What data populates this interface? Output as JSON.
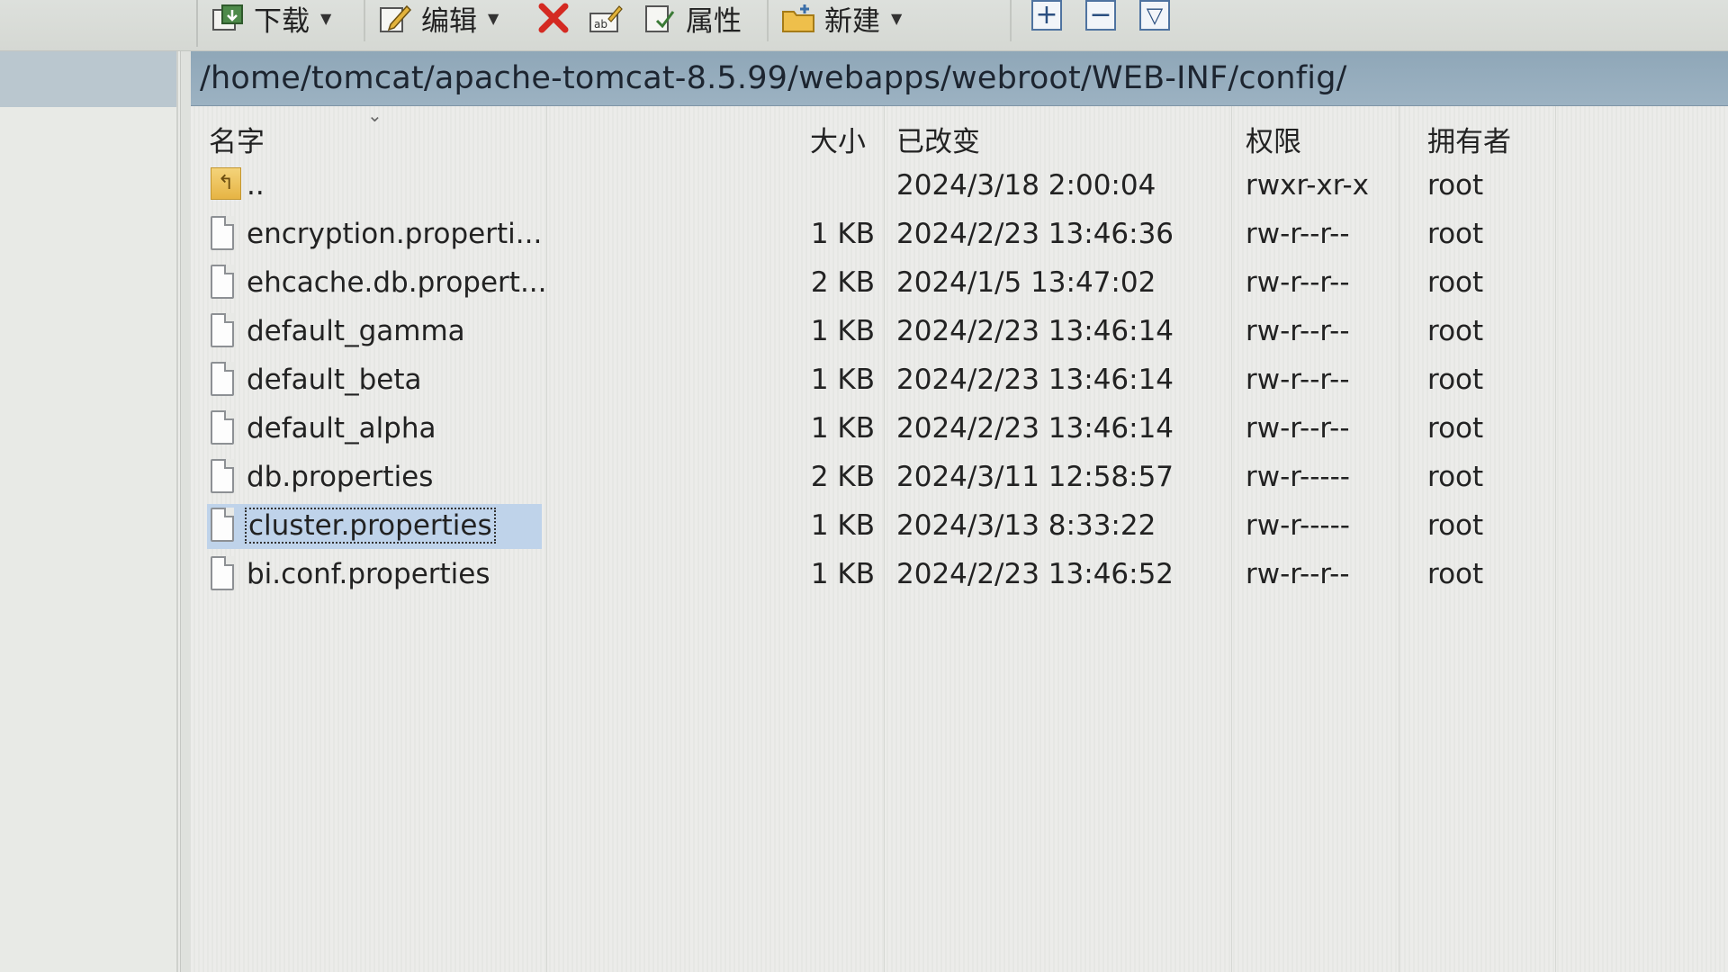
{
  "toolbar": {
    "download_label": "下载",
    "edit_label": "编辑",
    "properties_label": "属性",
    "new_label": "新建",
    "icons": [
      "download-icon",
      "edit-icon",
      "delete-icon",
      "rename-icon",
      "properties-icon",
      "new-folder-icon",
      "add-icon",
      "remove-icon",
      "filter-icon"
    ]
  },
  "path": "/home/tomcat/apache-tomcat-8.5.99/webapps/webroot/WEB-INF/config/",
  "columns": {
    "name": "名字",
    "size": "大小",
    "changed": "已改变",
    "rights": "权限",
    "owner": "拥有者"
  },
  "files": [
    {
      "name": "..",
      "size": "",
      "changed": "2024/3/18 2:00:04",
      "rights": "rwxr-xr-x",
      "owner": "root",
      "type": "parent"
    },
    {
      "name": "encryption.properti...",
      "size": "1 KB",
      "changed": "2024/2/23 13:46:36",
      "rights": "rw-r--r--",
      "owner": "root",
      "type": "file"
    },
    {
      "name": "ehcache.db.propert...",
      "size": "2 KB",
      "changed": "2024/1/5 13:47:02",
      "rights": "rw-r--r--",
      "owner": "root",
      "type": "file"
    },
    {
      "name": "default_gamma",
      "size": "1 KB",
      "changed": "2024/2/23 13:46:14",
      "rights": "rw-r--r--",
      "owner": "root",
      "type": "file"
    },
    {
      "name": "default_beta",
      "size": "1 KB",
      "changed": "2024/2/23 13:46:14",
      "rights": "rw-r--r--",
      "owner": "root",
      "type": "file"
    },
    {
      "name": "default_alpha",
      "size": "1 KB",
      "changed": "2024/2/23 13:46:14",
      "rights": "rw-r--r--",
      "owner": "root",
      "type": "file"
    },
    {
      "name": "db.properties",
      "size": "2 KB",
      "changed": "2024/3/11 12:58:57",
      "rights": "rw-r-----",
      "owner": "root",
      "type": "file"
    },
    {
      "name": "cluster.properties",
      "size": "1 KB",
      "changed": "2024/3/13 8:33:22",
      "rights": "rw-r-----",
      "owner": "root",
      "type": "file",
      "selected": true
    },
    {
      "name": "bi.conf.properties",
      "size": "1 KB",
      "changed": "2024/2/23 13:46:52",
      "rights": "rw-r--r--",
      "owner": "root",
      "type": "file"
    }
  ],
  "colors": {
    "path_bar": "#9cb2c2",
    "selection": "#bfd3ea",
    "delete_icon": "#d42a22"
  }
}
